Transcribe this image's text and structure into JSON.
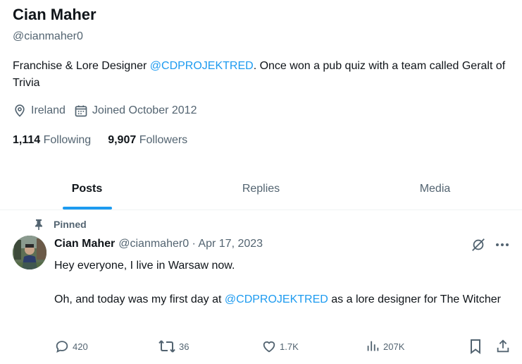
{
  "profile": {
    "name": "Cian Maher",
    "handle": "@cianmaher0",
    "bio_before": "Franchise & Lore Designer ",
    "bio_mention": "@CDPROJEKTRED",
    "bio_after": ". Once won a pub quiz with a team called Geralt of Trivia",
    "location": "Ireland",
    "joined": "Joined October 2012",
    "following_count": "1,114",
    "following_label": "Following",
    "followers_count": "9,907",
    "followers_label": "Followers"
  },
  "tabs": [
    {
      "label": "Posts",
      "active": true
    },
    {
      "label": "Replies",
      "active": false
    },
    {
      "label": "Media",
      "active": false
    }
  ],
  "tweet": {
    "pinned_label": "Pinned",
    "author": "Cian Maher",
    "meta": "@cianmaher0 · Apr 17, 2023",
    "line1": "Hey everyone, I live in Warsaw now.",
    "line2_before": "Oh, and today was my first day at ",
    "line2_mention": "@CDPROJEKTRED",
    "line2_after": " as a lore designer for The Witcher",
    "replies": "420",
    "reposts": "36",
    "likes": "1.7K",
    "views": "207K"
  },
  "icons": {
    "location": "location-pin-icon",
    "calendar": "calendar-icon",
    "pin": "pin-icon",
    "grok": "grok-icon",
    "more": "more-icon",
    "reply": "reply-icon",
    "repost": "repost-icon",
    "like": "heart-icon",
    "views": "views-icon",
    "bookmark": "bookmark-icon",
    "share": "share-icon"
  },
  "colors": {
    "accent": "#1d9bf0",
    "text": "#0f1419",
    "secondary": "#536471"
  }
}
